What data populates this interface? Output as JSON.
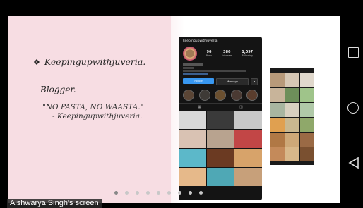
{
  "slide": {
    "handle": "Keepingupwithjuveria.",
    "role": "Blogger.",
    "quote": "\"NO PASTA, NO WAASTA.\"",
    "quote_attribution": "- Keepingupwithjuveria."
  },
  "profile": {
    "username": "keepingupwithjuveria",
    "posts": "96",
    "posts_label": "Posts",
    "followers": "386",
    "followers_label": "Followers",
    "following": "1,097",
    "following_label": "Following",
    "follow_button": "Follow",
    "message_button": "Message"
  },
  "pager": {
    "count": 9,
    "active": 0
  },
  "screen_label": "Aishwarya Singh's screen",
  "colors": {
    "pink": "#f7dde3",
    "follow_blue": "#3897f0"
  }
}
